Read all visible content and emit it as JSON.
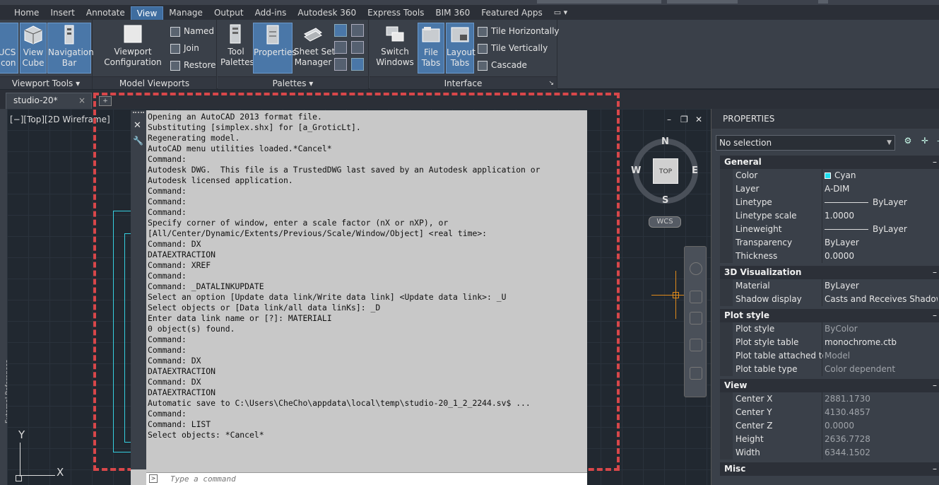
{
  "menu": {
    "tabs": [
      {
        "label": "Home"
      },
      {
        "label": "Insert"
      },
      {
        "label": "Annotate"
      },
      {
        "label": "View",
        "active": true
      },
      {
        "label": "Manage"
      },
      {
        "label": "Output"
      },
      {
        "label": "Add-ins"
      },
      {
        "label": "Autodesk 360"
      },
      {
        "label": "Express Tools"
      },
      {
        "label": "BIM 360"
      },
      {
        "label": "Featured Apps"
      }
    ]
  },
  "ribbon": {
    "viewport_tools": {
      "title": "Viewport Tools",
      "ucs_icon": "UCS\nIcon",
      "view_cube": "View\nCube",
      "navigation_bar": "Navigation\nBar"
    },
    "model_viewports": {
      "title": "Model Viewports",
      "viewport_configuration": "Viewport\nConfiguration",
      "named": "Named",
      "join": "Join",
      "restore": "Restore"
    },
    "palettes": {
      "title": "Palettes",
      "tool_palettes": "Tool\nPalettes",
      "properties": "Properties",
      "sheet_set_manager": "Sheet Set\nManager"
    },
    "interface": {
      "title": "Interface",
      "switch_windows": "Switch\nWindows",
      "file_tabs": "File\nTabs",
      "layout_tabs": "Layout\nTabs",
      "tile_horizontally": "Tile Horizontally",
      "tile_vertically": "Tile Vertically",
      "cascade": "Cascade"
    }
  },
  "file_tab": {
    "label": "studio-20*"
  },
  "viewport": {
    "label": "[−][Top][2D Wireframe]",
    "compass": {
      "n": "N",
      "s": "S",
      "e": "E",
      "w": "W",
      "top": "TOP"
    },
    "wcs": "WCS",
    "ucs_x": "X",
    "ucs_y": "Y",
    "external_refs": "External References"
  },
  "command": {
    "history": [
      "Opening an AutoCAD 2013 format file.",
      "Substituting [simplex.shx] for [a_GroticLt].",
      "Regenerating model.",
      "AutoCAD menu utilities loaded.*Cancel*",
      "Command:",
      "Autodesk DWG.  This file is a TrustedDWG last saved by an Autodesk application or",
      "Autodesk licensed application.",
      "Command:",
      "Command:",
      "Command:",
      "Specify corner of window, enter a scale factor (nX or nXP), or",
      "[All/Center/Dynamic/Extents/Previous/Scale/Window/Object] <real time>:",
      "Command: DX",
      "DATAEXTRACTION",
      "Command: XREF",
      "Command:",
      "Command: _DATALINKUPDATE",
      "Select an option [Update data link/Write data link] <Update data link>: _U",
      "Select objects or [Data link/all data linKs]: _D",
      "Enter data link name or [?]: MATERIALI",
      "0 object(s) found.",
      "Command:",
      "Command:",
      "Command: DX",
      "DATAEXTRACTION",
      "Command: DX",
      "DATAEXTRACTION",
      "Automatic save to C:\\Users\\CheCho\\appdata\\local\\temp\\studio-20_1_2_2244.sv$ ...",
      "Command:",
      "Command: LIST",
      "Select objects: *Cancel*"
    ],
    "input_placeholder": "Type a command"
  },
  "properties": {
    "title": "PROPERTIES",
    "selection": "No selection",
    "sections": [
      {
        "name": "General",
        "rows": [
          {
            "k": "Color",
            "v": "Cyan",
            "swatch": "#20e0f0"
          },
          {
            "k": "Layer",
            "v": "A-DIM"
          },
          {
            "k": "Linetype",
            "v": "ByLayer",
            "line": true
          },
          {
            "k": "Linetype scale",
            "v": "1.0000"
          },
          {
            "k": "Lineweight",
            "v": "ByLayer",
            "line": true
          },
          {
            "k": "Transparency",
            "v": "ByLayer"
          },
          {
            "k": "Thickness",
            "v": "0.0000"
          }
        ]
      },
      {
        "name": "3D Visualization",
        "rows": [
          {
            "k": "Material",
            "v": "ByLayer"
          },
          {
            "k": "Shadow display",
            "v": "Casts and Receives Shadows"
          }
        ]
      },
      {
        "name": "Plot style",
        "rows": [
          {
            "k": "Plot style",
            "v": "ByColor",
            "dim": true
          },
          {
            "k": "Plot style table",
            "v": "monochrome.ctb"
          },
          {
            "k": "Plot table attached to",
            "v": "Model",
            "dim": true
          },
          {
            "k": "Plot table type",
            "v": "Color dependent",
            "dim": true
          }
        ]
      },
      {
        "name": "View",
        "rows": [
          {
            "k": "Center X",
            "v": "2881.1730",
            "dim": true
          },
          {
            "k": "Center Y",
            "v": "4130.4857",
            "dim": true
          },
          {
            "k": "Center Z",
            "v": "0.0000",
            "dim": true
          },
          {
            "k": "Height",
            "v": "2636.7728",
            "dim": true
          },
          {
            "k": "Width",
            "v": "6344.1502",
            "dim": true
          }
        ]
      },
      {
        "name": "Misc",
        "rows": []
      }
    ]
  }
}
